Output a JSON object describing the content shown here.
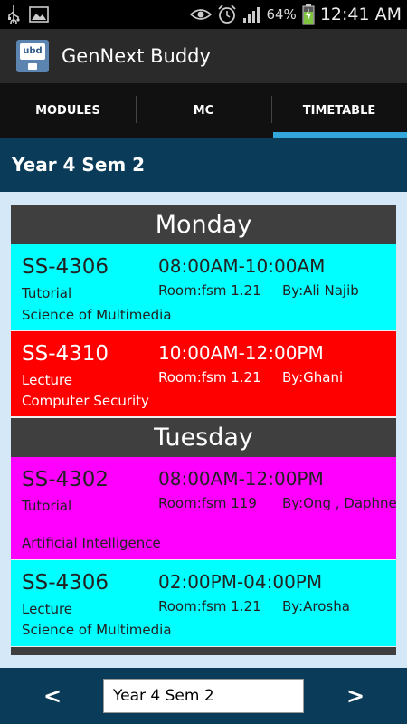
{
  "statusbar": {
    "battery_pct": "64%",
    "time": "12:41 AM",
    "icons": [
      "usb-icon",
      "image-icon",
      "eye-icon",
      "alarm-icon",
      "signal-icon",
      "battery-charging-icon"
    ]
  },
  "app": {
    "title": "GenNext Buddy",
    "logo_text": "ubd"
  },
  "tabs": [
    {
      "label": "MODULES",
      "active": false
    },
    {
      "label": "MC",
      "active": false
    },
    {
      "label": "TIMETABLE",
      "active": true
    }
  ],
  "semester_header": "Year 4 Sem 2",
  "schedule": [
    {
      "day": "Monday",
      "classes": [
        {
          "code": "SS-4306",
          "time": "08:00AM-10:00AM",
          "type": "Tutorial",
          "room": "Room:fsm 1.21",
          "by": "By:Ali Najib",
          "name": "Science of Multimedia",
          "color": "#00ffff"
        },
        {
          "code": "SS-4310",
          "time": "10:00AM-12:00PM",
          "type": "Lecture",
          "room": "Room:fsm 1.21",
          "by": "By:Ghani",
          "name": "Computer Security",
          "color": "#ff0000"
        }
      ]
    },
    {
      "day": "Tuesday",
      "classes": [
        {
          "code": "SS-4302",
          "time": "08:00AM-12:00PM",
          "type": "Tutorial",
          "room": "Room:fsm 119",
          "by": "By:Ong , Daphne",
          "name": "Artificial Intelligence",
          "color": "#ff00ff"
        },
        {
          "code": "SS-4306",
          "time": "02:00PM-04:00PM",
          "type": "Lecture",
          "room": "Room:fsm 1.21",
          "by": "By:Arosha",
          "name": "Science of Multimedia",
          "color": "#00ffff"
        }
      ]
    }
  ],
  "bottombar": {
    "prev_label": "<",
    "next_label": ">",
    "semester_select_value": "Year 4 Sem 2"
  },
  "colors": {
    "accent": "#33a6dc",
    "content_bg": "#0a3c5a",
    "panel_bg": "#d4e8f8",
    "day_header_bg": "#3f3f3f"
  }
}
